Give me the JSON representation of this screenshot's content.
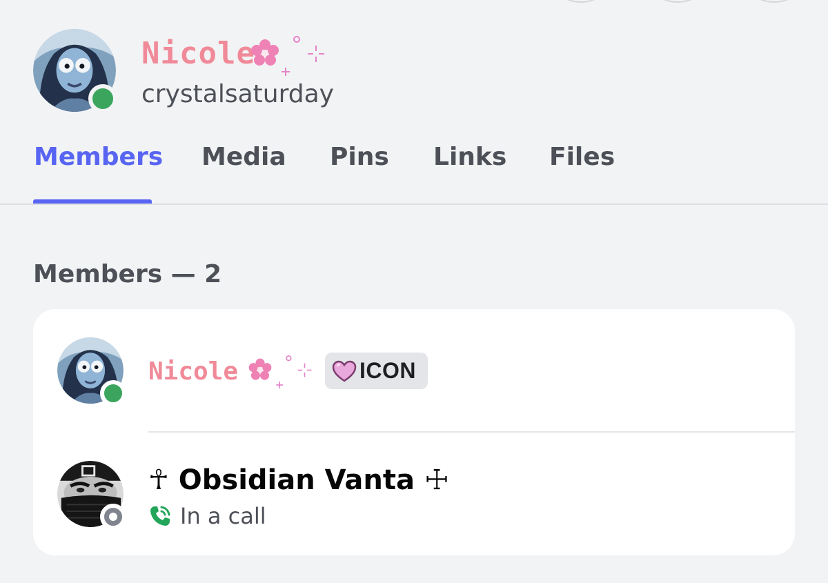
{
  "profile": {
    "display_name": "Nicole",
    "username": "crystalsaturday",
    "status": "online",
    "avatar": "corpse-bride-avatar"
  },
  "tabs": [
    {
      "label": "Members",
      "active": true
    },
    {
      "label": "Media",
      "active": false
    },
    {
      "label": "Pins",
      "active": false
    },
    {
      "label": "Links",
      "active": false
    },
    {
      "label": "Files",
      "active": false
    }
  ],
  "members_section": {
    "heading": "Members — 2",
    "members": [
      {
        "name": "Nicole",
        "status": "online",
        "role_badge": {
          "icon": "pink-heart-icon",
          "label": "ICON"
        },
        "avatar": "corpse-bride-avatar"
      },
      {
        "name": "☥ Obsidian Vanta ☩",
        "status": "offline",
        "activity": {
          "icon": "phone-call-icon",
          "text": "In a call"
        },
        "avatar": "masked-face-avatar"
      }
    ]
  },
  "colors": {
    "accent": "#5865f2",
    "online": "#3ba55d",
    "offline": "#80848e",
    "name_pink": "#f08a98",
    "deco_pink": "#e483c9",
    "call_green": "#23a55a"
  }
}
